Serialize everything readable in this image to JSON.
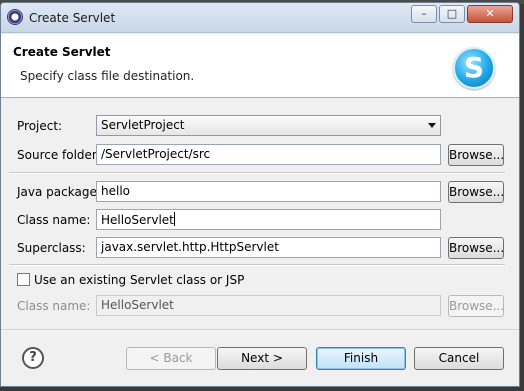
{
  "window": {
    "title": "Create Servlet"
  },
  "header": {
    "title": "Create Servlet",
    "subtitle": "Specify class file destination.",
    "logo_letter": "S"
  },
  "form": {
    "project": {
      "label": "Project:",
      "value": "ServletProject"
    },
    "source_folder": {
      "label": "Source folder:",
      "value": "/ServletProject/src"
    },
    "java_package": {
      "label": "Java package:",
      "value": "hello"
    },
    "class_name": {
      "label": "Class name:",
      "value": "HelloServlet"
    },
    "superclass": {
      "label": "Superclass:",
      "value": "javax.servlet.http.HttpServlet"
    },
    "use_existing": {
      "label": "Use an existing Servlet class or JSP",
      "checked": false
    },
    "existing_class_name": {
      "label": "Class name:",
      "value": "HelloServlet"
    },
    "browse_label": "Browse..."
  },
  "footer": {
    "help_glyph": "?",
    "back_label": "< Back",
    "next_label": "Next >",
    "finish_label": "Finish",
    "cancel_label": "Cancel"
  },
  "titlebar_buttons": {
    "minimize": "–",
    "maximize": "□",
    "close": "✕"
  }
}
